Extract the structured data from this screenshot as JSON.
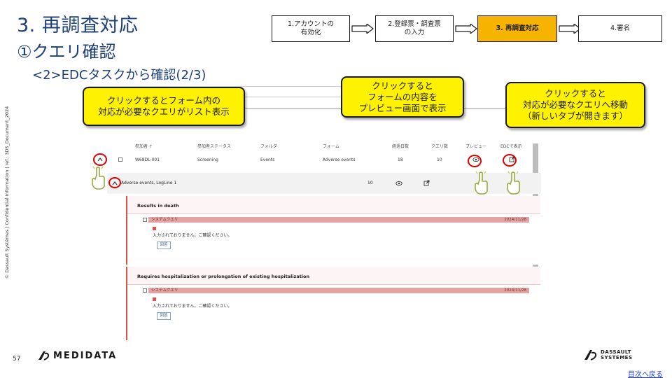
{
  "title": {
    "main": "3. 再調査対応",
    "sub": "①クエリ確認",
    "sub2": "<2>EDCタスクから確認(2/3)"
  },
  "flow": {
    "steps": [
      {
        "label": "1.アカウントの\n有効化"
      },
      {
        "label": "2.登録票・調査票\nの入力"
      },
      {
        "label": "3. 再調査対応"
      },
      {
        "label": "4.署名"
      }
    ]
  },
  "side_note": "© Dassault Systèmes | Confidential Information | ref.: 3DS_Document_2024",
  "bubbles": {
    "left": "クリックするとフォーム内の\n対応が必要なクエリがリスト表示",
    "middle": "クリックすると\nフォームの内容を\nプレビュー画面で表示",
    "right": "クリックすると\n対応が必要なクエリへ移動\n（新しいタブが開きます）"
  },
  "table": {
    "headers": {
      "subject": "参加者 ↑",
      "status": "参加者ステータス",
      "folder": "フォルダ",
      "form": "フォーム",
      "days": "経過日数",
      "queries": "クエリ数",
      "preview": "プレビュー",
      "edc": "EDCで表示"
    },
    "row": {
      "subject": "W68DL-001",
      "status": "Screening",
      "folder": "Events",
      "form": "Adverse events",
      "days": "18",
      "queries": "10"
    },
    "sub_row": {
      "label": "Adverse events, LogLine 1",
      "count": "10"
    }
  },
  "cards": [
    {
      "heading": "Results in death",
      "query_label": "システムクエリ",
      "query_date": "2024/11/28",
      "message": "入力されておりません。ご確認ください。",
      "button": "回答"
    },
    {
      "heading": "Requires hospitalization or prolongation of existing hospitalization",
      "query_label": "システムクエリ",
      "query_date": "2024/11/28",
      "message": "入力されておりません。ご確認ください。",
      "button": "回答"
    }
  ],
  "footer": {
    "page": "57",
    "brand": "MEDIDATA",
    "ds_line1": "DASSAULT",
    "ds_line2": "SYSTEMES",
    "back_link": "目次へ戻る"
  },
  "colors": {
    "title": "#1c3f7a",
    "active_step": "#f6b300",
    "bubble": "#fff200",
    "marker": "#e00000",
    "query_bar": "#e3a3a3"
  }
}
